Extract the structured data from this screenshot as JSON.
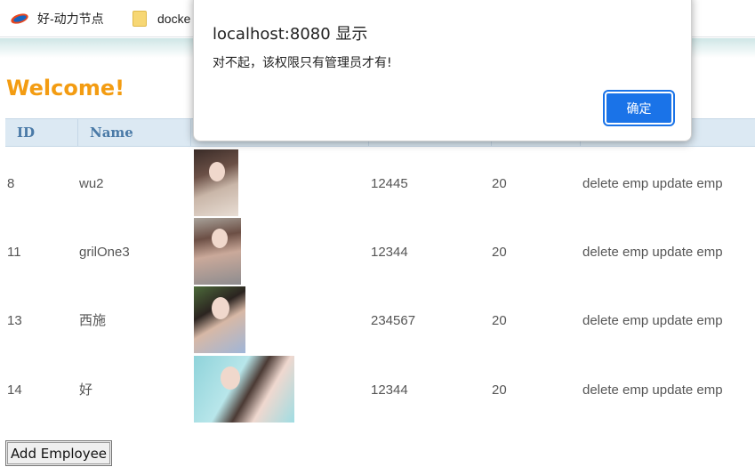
{
  "bookmarks": [
    {
      "label": "好-动力节点",
      "icon": "site-logo-icon"
    },
    {
      "label": "docke",
      "icon": "folder-icon"
    }
  ],
  "page": {
    "welcome": "Welcome!",
    "columns": [
      "ID",
      "Name",
      "",
      "",
      "",
      ""
    ],
    "rows": [
      {
        "id": "8",
        "name": "wu2",
        "salary": "12445",
        "age": "20"
      },
      {
        "id": "11",
        "name": "grilOne3",
        "salary": "12344",
        "age": "20"
      },
      {
        "id": "13",
        "name": "西施",
        "salary": "234567",
        "age": "20"
      },
      {
        "id": "14",
        "name": "好",
        "salary": "12344",
        "age": "20"
      }
    ],
    "ops": {
      "delete": "delete emp",
      "update": "update emp"
    },
    "add_button": "Add Employee"
  },
  "dialog": {
    "title": "localhost:8080 显示",
    "message": "对不起，该权限只有管理员才有!",
    "ok_label": "确定"
  },
  "colors": {
    "welcome": "#f39c12",
    "header_bg": "#dce9f3",
    "header_text": "#4a7aa7",
    "ok_button": "#1a73e8"
  }
}
